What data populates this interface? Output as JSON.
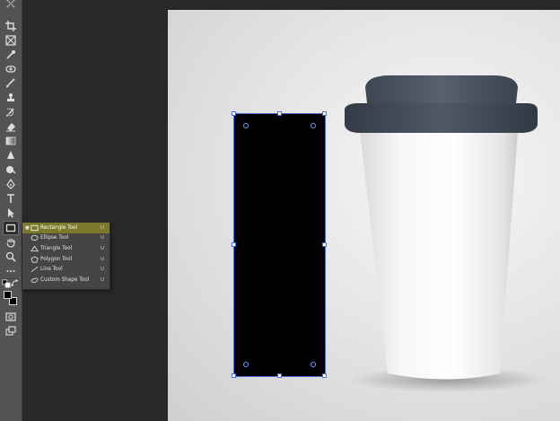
{
  "toolbar": {
    "tools": [
      {
        "name": "marquee-tool-icon"
      },
      {
        "name": "crop-tool-icon"
      },
      {
        "name": "frame-tool-icon"
      },
      {
        "name": "eyedropper-tool-icon"
      },
      {
        "name": "healing-brush-icon"
      },
      {
        "name": "brush-tool-icon"
      },
      {
        "name": "clone-stamp-icon"
      },
      {
        "name": "history-brush-icon"
      },
      {
        "name": "eraser-tool-icon"
      },
      {
        "name": "gradient-tool-icon"
      },
      {
        "name": "blur-tool-icon"
      },
      {
        "name": "dodge-tool-icon"
      },
      {
        "name": "pen-tool-icon"
      },
      {
        "name": "type-tool-icon"
      },
      {
        "name": "path-selection-icon"
      },
      {
        "name": "rectangle-tool-icon"
      },
      {
        "name": "hand-tool-icon"
      },
      {
        "name": "zoom-tool-icon"
      },
      {
        "name": "more-tools-icon"
      }
    ],
    "foreground_color": "#000000",
    "background_color": "#000000"
  },
  "shape_flyout": {
    "items": [
      {
        "label": "Rectangle Tool",
        "shortcut": "U",
        "icon": "rectangle-icon",
        "selected": true
      },
      {
        "label": "Ellipse Tool",
        "shortcut": "U",
        "icon": "ellipse-icon",
        "selected": false
      },
      {
        "label": "Triangle Tool",
        "shortcut": "U",
        "icon": "triangle-icon",
        "selected": false
      },
      {
        "label": "Polygon Tool",
        "shortcut": "U",
        "icon": "polygon-icon",
        "selected": false
      },
      {
        "label": "Line Tool",
        "shortcut": "U",
        "icon": "line-icon",
        "selected": false
      },
      {
        "label": "Custom Shape Tool",
        "shortcut": "U",
        "icon": "custom-shape-icon",
        "selected": false
      }
    ]
  },
  "canvas": {
    "background": "#e9e9e9",
    "shape_fill": "#000000",
    "selection_color": "#4b6bd6",
    "cup_lid_color": "#4c5564"
  }
}
